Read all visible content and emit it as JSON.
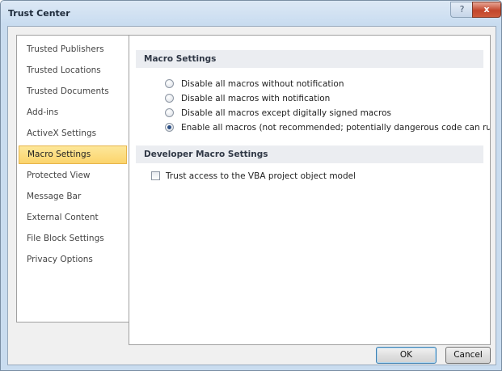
{
  "window": {
    "title": "Trust Center",
    "help_glyph": "?",
    "close_glyph": "x"
  },
  "nav": {
    "items": [
      {
        "label": "Trusted Publishers",
        "selected": false
      },
      {
        "label": "Trusted Locations",
        "selected": false
      },
      {
        "label": "Trusted Documents",
        "selected": false
      },
      {
        "label": "Add-ins",
        "selected": false
      },
      {
        "label": "ActiveX Settings",
        "selected": false
      },
      {
        "label": "Macro Settings",
        "selected": true
      },
      {
        "label": "Protected View",
        "selected": false
      },
      {
        "label": "Message Bar",
        "selected": false
      },
      {
        "label": "External Content",
        "selected": false
      },
      {
        "label": "File Block Settings",
        "selected": false
      },
      {
        "label": "Privacy Options",
        "selected": false
      }
    ]
  },
  "macro_settings": {
    "header": "Macro Settings",
    "options": [
      {
        "label": "Disable all macros without notification",
        "checked": false
      },
      {
        "label": "Disable all macros with notification",
        "checked": false
      },
      {
        "label": "Disable all macros except digitally signed macros",
        "checked": false
      },
      {
        "label": "Enable all macros (not recommended; potentially dangerous code can run)",
        "checked": true
      }
    ]
  },
  "developer_settings": {
    "header": "Developer Macro Settings",
    "vba_access_label": "Trust access to the VBA project object model",
    "vba_access_checked": false
  },
  "buttons": {
    "ok": "OK",
    "cancel": "Cancel"
  }
}
